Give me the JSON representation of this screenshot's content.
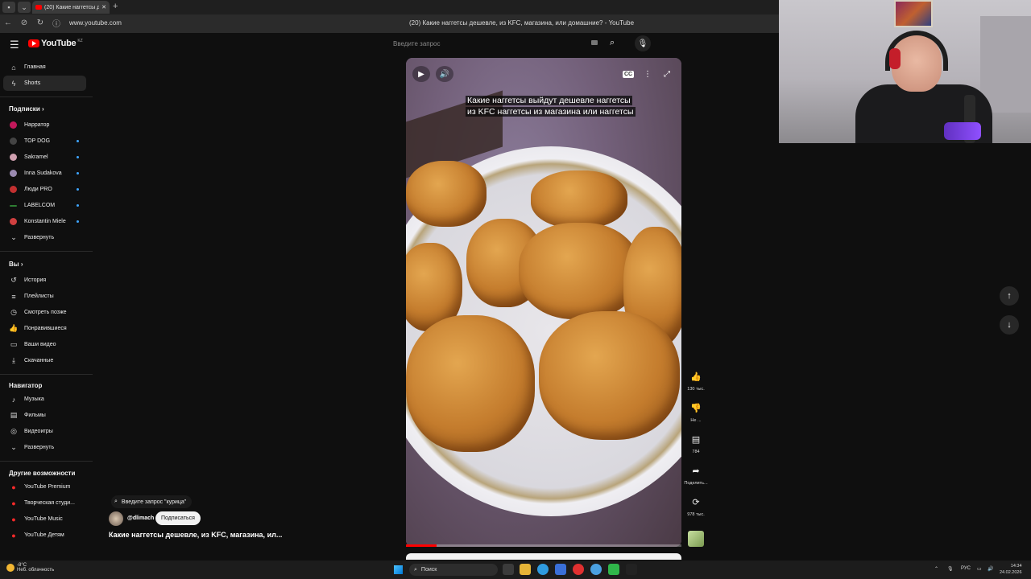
{
  "browser": {
    "tab_title": "(20) Какие наггетсы дe...",
    "url": "www.youtube.com",
    "page_title": "(20) Какие наггетсы дешевле, из KFC, магазина, или домашние? - YouTube"
  },
  "masthead": {
    "logo_text": "YouTube",
    "logo_region": "KZ",
    "search_placeholder": "Введите запрос"
  },
  "sidebar": {
    "main": [
      {
        "label": "Главная",
        "icon": "home-icon"
      },
      {
        "label": "Shorts",
        "icon": "shorts-icon"
      }
    ],
    "subscriptions_header": "Подписки",
    "subscriptions": [
      {
        "label": "Нарратор",
        "color": "#c2185b",
        "dot": false
      },
      {
        "label": "TOP DOG",
        "color": "#444444",
        "dot": true
      },
      {
        "label": "Sakramel",
        "color": "#d0a0b0",
        "dot": true
      },
      {
        "label": "Inna Sudakova",
        "color": "#9a8ab0",
        "dot": true
      },
      {
        "label": "Люди PRO",
        "color": "#c23030",
        "dot": true
      },
      {
        "label": "LABELCOM",
        "color": "#2e7d32",
        "dot": true
      },
      {
        "label": "Konstantin Miele",
        "color": "#d04040",
        "dot": true
      }
    ],
    "expand_label": "Развернуть",
    "you_header": "Вы",
    "you_items": [
      {
        "label": "История",
        "icon": "history-icon"
      },
      {
        "label": "Плейлисты",
        "icon": "playlists-icon"
      },
      {
        "label": "Смотреть позже",
        "icon": "watch-later-icon"
      },
      {
        "label": "Понравившиеся",
        "icon": "liked-icon"
      },
      {
        "label": "Ваши видео",
        "icon": "your-videos-icon"
      },
      {
        "label": "Скачанные",
        "icon": "downloads-icon"
      }
    ],
    "navigator_header": "Навигатор",
    "navigator_items": [
      {
        "label": "Музыка",
        "icon": "music-icon"
      },
      {
        "label": "Фильмы",
        "icon": "movies-icon"
      },
      {
        "label": "Видеоигры",
        "icon": "gaming-icon"
      },
      {
        "label": "Развернуть",
        "icon": "chevron-down-icon"
      }
    ],
    "more_header": "Другие возможности",
    "more_items": [
      {
        "label": "YouTube Premium"
      },
      {
        "label": "Творческая студи..."
      },
      {
        "label": "YouTube Music"
      },
      {
        "label": "YouTube Детям"
      }
    ]
  },
  "short": {
    "caption_line1": "Какие наггетсы выйдут дешевле наггетсы",
    "caption_line2": "из KFC наггетсы из магазина или наггетсы",
    "progress": 0.11,
    "search_chip": "Введите запрос \"курица\"",
    "channel": "@dlimach",
    "subscribe_label": "Подписаться",
    "title": "Какие наггетсы дешевле, из KFC, магазина, ил..."
  },
  "actions": {
    "like_count": "130 тыс.",
    "dislike_label": "Не ...",
    "comments_count": "784",
    "share_label": "Поделить...",
    "remix_count": "978 тыс."
  },
  "taskbar": {
    "temperature": "-8°C",
    "weather": "Неб. облачность",
    "search_label": "Поиск",
    "lang": "РУС",
    "time": "14:34",
    "date": "24.02.2026"
  }
}
